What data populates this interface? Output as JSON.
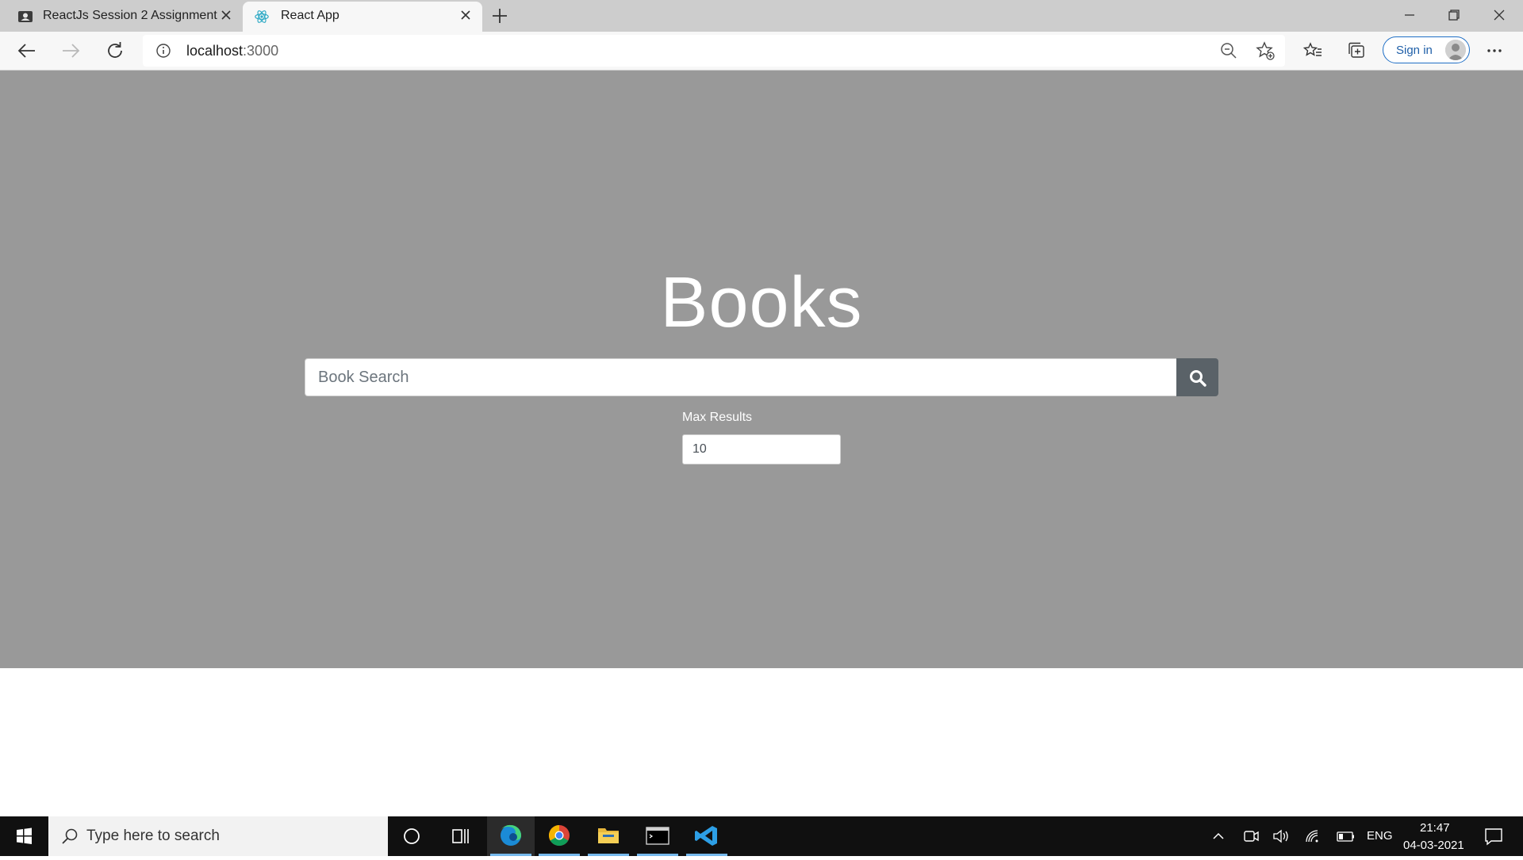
{
  "browser": {
    "tabs": [
      {
        "title": "ReactJs Session 2 Assignment",
        "active": false
      },
      {
        "title": "React App",
        "active": true
      }
    ],
    "address": {
      "host": "localhost",
      "port": ":3000"
    },
    "signin_label": "Sign in"
  },
  "page": {
    "heading": "Books",
    "search_placeholder": "Book Search",
    "max_results_label": "Max Results",
    "max_results_value": "10"
  },
  "taskbar": {
    "search_placeholder": "Type here to search",
    "language": "ENG",
    "time": "21:47",
    "date": "04-03-2021"
  },
  "colors": {
    "hero_bg": "#999999",
    "search_button": "#5a6268",
    "signin_accent": "#1f6fc6"
  }
}
